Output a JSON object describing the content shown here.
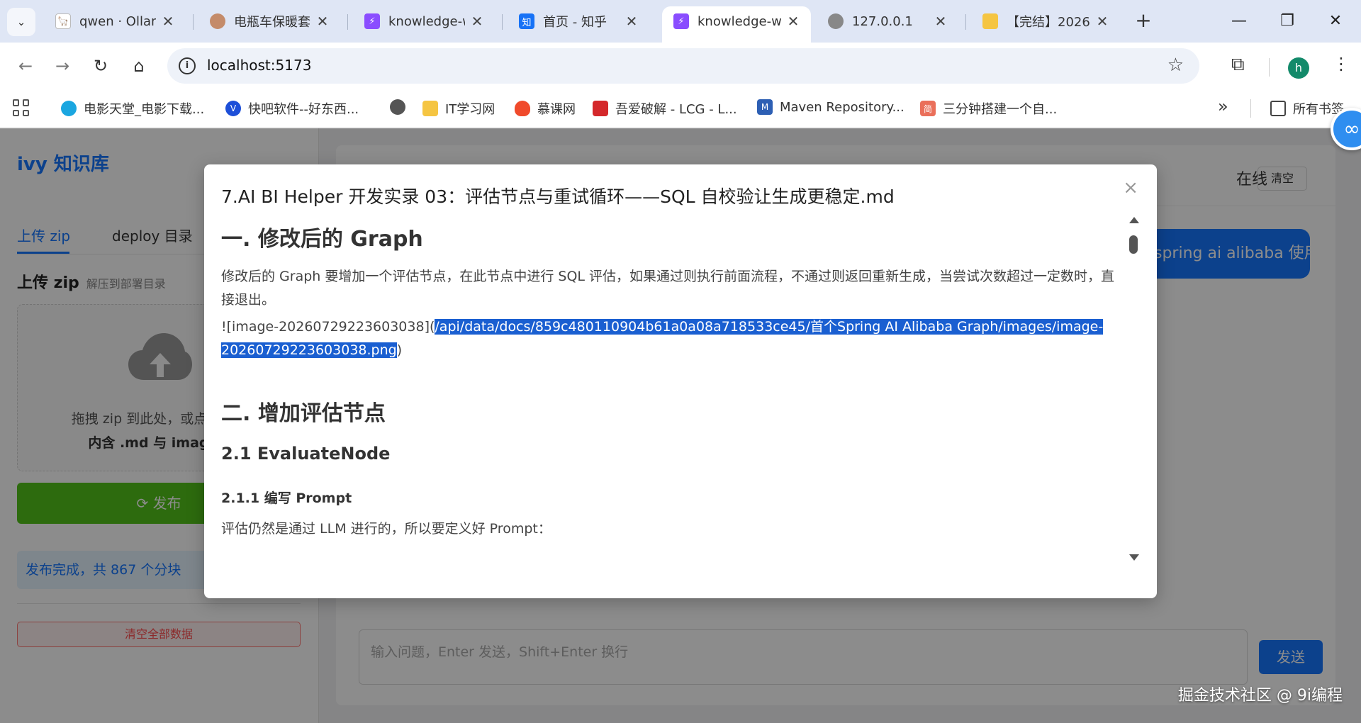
{
  "tabs": [
    {
      "title": "qwen · Ollama",
      "favicon": "ollama-icon",
      "fav_bg": "#ffffff",
      "fav_fg": "#222"
    },
    {
      "title": "电瓶车保暖套",
      "favicon": "avatar-icon",
      "fav_bg": "#c48b6a",
      "fav_fg": "#fff"
    },
    {
      "title": "knowledge-web",
      "favicon": "vite-icon",
      "fav_bg": "#8a4dff",
      "fav_fg": "#fff"
    },
    {
      "title": "首页 - 知乎",
      "favicon": "zhihu-icon",
      "fav_bg": "#1772f6",
      "fav_fg": "#fff"
    },
    {
      "title": "knowledge-web",
      "favicon": "vite-icon",
      "fav_bg": "#8a4dff",
      "fav_fg": "#fff",
      "active": true
    },
    {
      "title": "127.0.0.1",
      "favicon": "globe-icon",
      "fav_bg": "#888888",
      "fav_fg": "#fff"
    },
    {
      "title": "【完结】2026",
      "favicon": "note-icon",
      "fav_bg": "#f5c542",
      "fav_fg": "#fff"
    }
  ],
  "tab_close_glyph": "✕",
  "new_tab_glyph": "+",
  "window": {
    "minimize": "—",
    "restore": "❐",
    "close": "✕"
  },
  "address": {
    "url": "localhost:5173",
    "info_glyph": "i"
  },
  "profile_initial": "h",
  "bookmarks": [
    {
      "label": "电影天堂_电影下载...",
      "icon": "dytt-icon",
      "bg": "#1aa6e0"
    },
    {
      "label": "快吧软件--好东西...",
      "icon": "kuaiba-icon",
      "bg": "#1d4fd8"
    },
    {
      "label": "",
      "icon": "globe-icon",
      "bg": "#555555"
    },
    {
      "label": "IT学习网",
      "icon": "note-icon",
      "bg": "#f5c542"
    },
    {
      "label": "慕课网",
      "icon": "flame-icon",
      "bg": "#f04a2b"
    },
    {
      "label": "吾爱破解 - LCG - L...",
      "icon": "52pojie-icon",
      "bg": "#d4282b"
    },
    {
      "label": "Maven Repository...",
      "icon": "maven-icon",
      "bg": "#2d5fb4"
    },
    {
      "label": "三分钟搭建一个自...",
      "icon": "jian-icon",
      "bg": "#ea6f5a"
    }
  ],
  "bookmarks_more": "»",
  "all_bookmarks": "所有书签",
  "sidebar": {
    "brand": "ivy 知识库",
    "tabs": [
      "上传 zip",
      "deploy 目录"
    ],
    "section_title": "上传 zip",
    "section_sub": "解压到部署目录",
    "drop_line1": "拖拽 zip 到此处，或点击选择",
    "drop_line2": "内含 .md 与 images/",
    "publish": "发布",
    "publish_icon": "⟳",
    "done_message": "发布完成，共 867 个分块",
    "clear_all": "清空全部数据"
  },
  "main": {
    "status": "在线",
    "clear": "清空",
    "bubble": "spring ai alibaba 使用",
    "input_placeholder": "输入问题，Enter 发送，Shift+Enter 换行",
    "send": "发送"
  },
  "modal": {
    "title": "7.AI BI Helper 开发实录 03：评估节点与重试循环——SQL 自校验让生成更稳定.md",
    "close": "×",
    "h1_1": "一. 修改后的 Graph",
    "p1": "修改后的 Graph 要增加一个评估节点，在此节点中进行 SQL 评估，如果通过则执行前面流程，不通过则返回重新生成，当尝试次数超过一定数时，直接退出。",
    "img_prefix": "![image-20260729223603038](",
    "img_path_line1": "/api/data/docs/859c480110904b61a0a08a718533ce45/首个Spring AI Alibaba Graph/images/image-",
    "img_path_line2": "20260729223603038.png",
    "img_suffix": ")",
    "h1_2": "二. 增加评估节点",
    "h2_1": "2.1 EvaluateNode",
    "h3_1": "2.1.1 编写 Prompt",
    "p2": "评估仍然是通过 LLM 进行的，所以要定义好 Prompt："
  },
  "watermark": "掘金技术社区 @ 9i编程",
  "colors": {
    "accent": "#1677ff",
    "success": "#52c41a",
    "danger": "#ff4d4f",
    "selection": "#1a5fd1"
  }
}
